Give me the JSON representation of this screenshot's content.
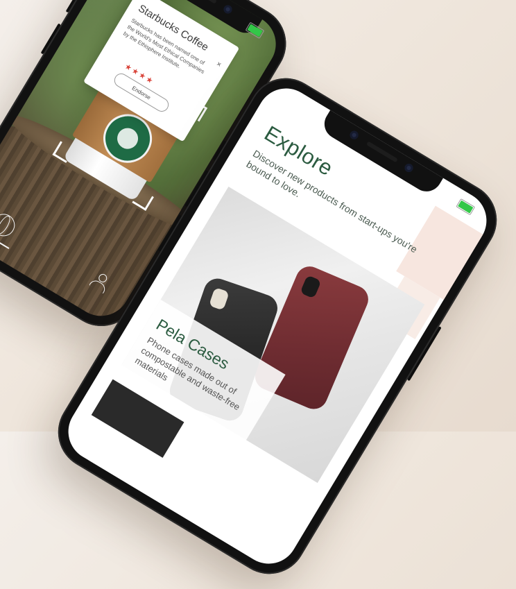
{
  "left_phone": {
    "card": {
      "title": "Starbucks Coffee",
      "body": "Starbucks has been named one of the World's Most Ethical Companies by the Ethisphere Institute.",
      "close": "×",
      "rating": 4,
      "stars": "★★★★",
      "button": "Endorse"
    },
    "nav": {
      "globe_icon": "globe-icon",
      "profile_icon": "person-icon"
    }
  },
  "right_phone": {
    "title": "Explore",
    "subtitle": "Discover new products from start-ups you're bound to love.",
    "feature": {
      "title": "Pela Cases",
      "description": "Phone cases made out of compostable and waste-free materials"
    }
  },
  "colors": {
    "accent_green": "#2b5b40",
    "star_red": "#d9443a",
    "battery_green": "#33c748"
  }
}
